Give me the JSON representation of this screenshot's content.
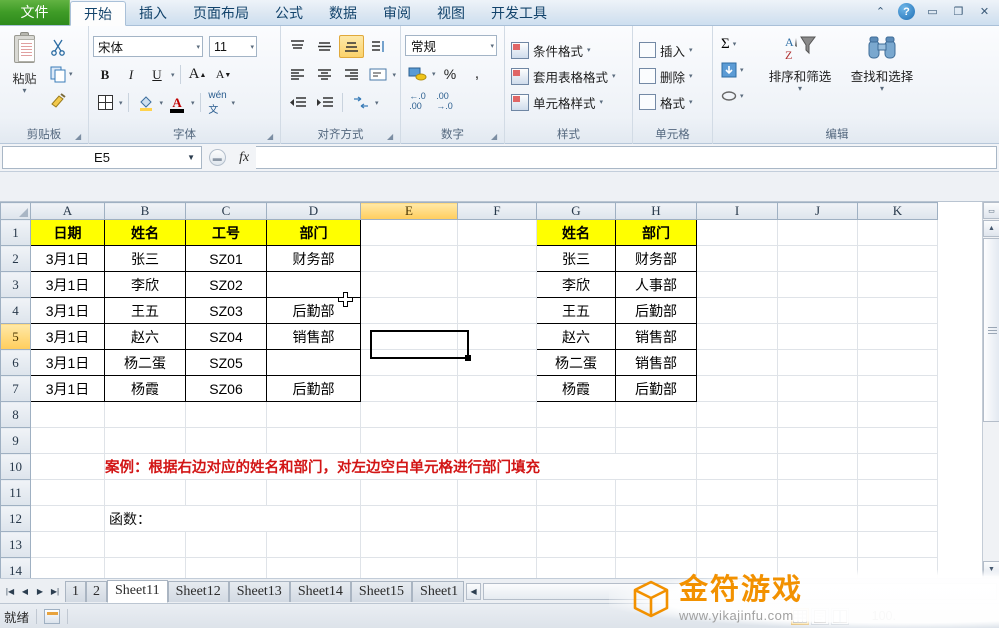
{
  "titlebar": {
    "file_tab": "文件",
    "tabs": [
      "开始",
      "插入",
      "页面布局",
      "公式",
      "数据",
      "审阅",
      "视图",
      "开发工具"
    ],
    "active_tab": "开始",
    "ribbon_collapse_icon": "chevron-up-icon",
    "help_label": "?",
    "minimize": "—",
    "restore": "❐",
    "close": "✕"
  },
  "ribbon": {
    "clipboard": {
      "group_label": "剪贴板",
      "paste_label": "粘贴",
      "cut_icon": "scissors-icon",
      "copy_icon": "copy-icon",
      "format_painter_icon": "format-painter-icon"
    },
    "font": {
      "group_label": "字体",
      "font_name": "宋体",
      "font_size": "11",
      "bold": "B",
      "italic": "I",
      "underline": "U",
      "grow_font": "A",
      "shrink_font": "A",
      "borders_icon": "borders-icon",
      "fill_color_icon": "fill-color-icon",
      "font_color": "A",
      "phonetic_icon": "phonetic-guide-icon"
    },
    "alignment": {
      "group_label": "对齐方式",
      "top_align": "top-align-icon",
      "middle_align": "middle-align-icon",
      "bottom_align": "bottom-align-icon",
      "orientation": "orientation-icon",
      "align_left": "align-left-icon",
      "align_center": "align-center-icon",
      "align_right": "align-right-icon",
      "wrap_text": "wrap-text-icon",
      "decrease_indent": "decrease-indent-icon",
      "increase_indent": "increase-indent-icon",
      "merge_center": "merge-center-icon"
    },
    "number": {
      "group_label": "数字",
      "format": "常规",
      "accounting": "accounting-format-icon",
      "percent": "%",
      "comma": ",",
      "increase_decimal": ".00",
      "decrease_decimal": ".0"
    },
    "styles": {
      "group_label": "样式",
      "conditional_formatting": "条件格式",
      "format_as_table": "套用表格格式",
      "cell_styles": "单元格样式"
    },
    "cells": {
      "group_label": "单元格",
      "insert": "插入",
      "delete": "删除",
      "format": "格式"
    },
    "editing": {
      "group_label": "编辑",
      "autosum": "Σ",
      "fill_icon": "fill-down-icon",
      "clear_icon": "eraser-icon",
      "sort_filter": "排序和筛选",
      "find_select": "查找和选择"
    }
  },
  "formula_bar": {
    "name_box_value": "E5",
    "formula_value": "",
    "fx_label": "fx",
    "dropdown_icon": "chevron-down-icon"
  },
  "grid": {
    "column_headers": [
      "A",
      "B",
      "C",
      "D",
      "E",
      "F",
      "G",
      "H",
      "I",
      "J",
      "K"
    ],
    "active_column": "E",
    "active_row": "5",
    "selected_cell": "E5",
    "row_numbers": [
      "1",
      "2",
      "3",
      "4",
      "5",
      "6",
      "7",
      "8",
      "9",
      "10",
      "11",
      "12",
      "13",
      "14"
    ],
    "left_table": {
      "headers": [
        "日期",
        "姓名",
        "工号",
        "部门"
      ],
      "rows": [
        [
          "3月1日",
          "张三",
          "SZ01",
          "财务部"
        ],
        [
          "3月1日",
          "李欣",
          "SZ02",
          ""
        ],
        [
          "3月1日",
          "王五",
          "SZ03",
          "后勤部"
        ],
        [
          "3月1日",
          "赵六",
          "SZ04",
          "销售部"
        ],
        [
          "3月1日",
          "杨二蛋",
          "SZ05",
          ""
        ],
        [
          "3月1日",
          "杨霞",
          "SZ06",
          "后勤部"
        ]
      ]
    },
    "right_table": {
      "headers": [
        "姓名",
        "部门"
      ],
      "rows": [
        [
          "张三",
          "财务部"
        ],
        [
          "李欣",
          "人事部"
        ],
        [
          "王五",
          "后勤部"
        ],
        [
          "赵六",
          "销售部"
        ],
        [
          "杨二蛋",
          "销售部"
        ],
        [
          "杨霞",
          "后勤部"
        ]
      ]
    },
    "annotation": "案例：根据右边对应的姓名和部门，对左边空白单元格进行部门填充",
    "function_label": "函数：",
    "header_fill_color": "#ffff00",
    "annotation_color": "#d21515"
  },
  "sheet_tabs": {
    "first_icon": "first-sheet-icon",
    "prev_icon": "prev-sheet-icon",
    "next_icon": "next-sheet-icon",
    "last_icon": "last-sheet-icon",
    "tabs": [
      "1",
      "2",
      "Sheet11",
      "Sheet12",
      "Sheet13",
      "Sheet14",
      "Sheet15",
      "Sheet1"
    ],
    "active_tab": "Sheet11"
  },
  "status_bar": {
    "status": "就绪",
    "record_icon": "macro-record-icon",
    "view_normal": "normal-view-icon",
    "view_layout": "page-layout-icon",
    "view_break": "page-break-view-icon",
    "zoom": "100."
  },
  "watermark": {
    "title": "金符游戏",
    "url": "www.yikajinfu.com",
    "cube_icon": "cube-logo-icon",
    "color": "#f29100"
  }
}
